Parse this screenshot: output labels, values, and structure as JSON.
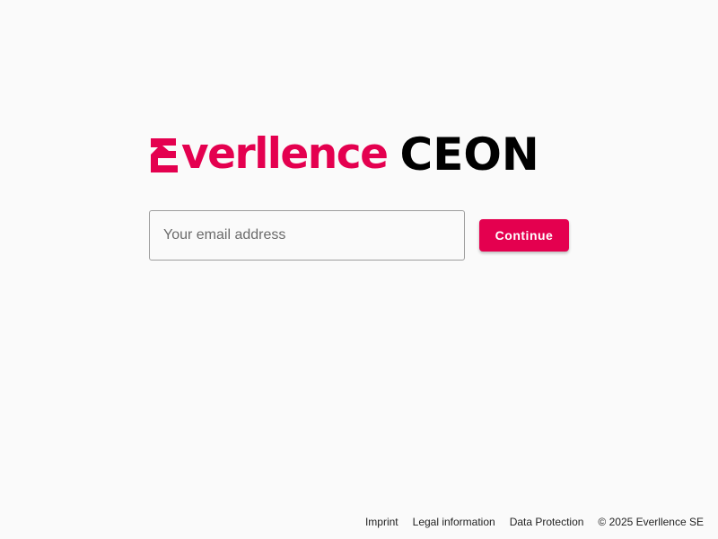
{
  "colors": {
    "brand": "#e4004f",
    "product": "#000000",
    "background": "#fafafa"
  },
  "logo": {
    "brand_rest": "verllence",
    "product": "CEON"
  },
  "login": {
    "email_placeholder": "Your email address",
    "email_value": "",
    "continue_label": "Continue"
  },
  "footer": {
    "links": [
      "Imprint",
      "Legal information",
      "Data Protection"
    ],
    "copyright": "© 2025 Everllence SE"
  }
}
